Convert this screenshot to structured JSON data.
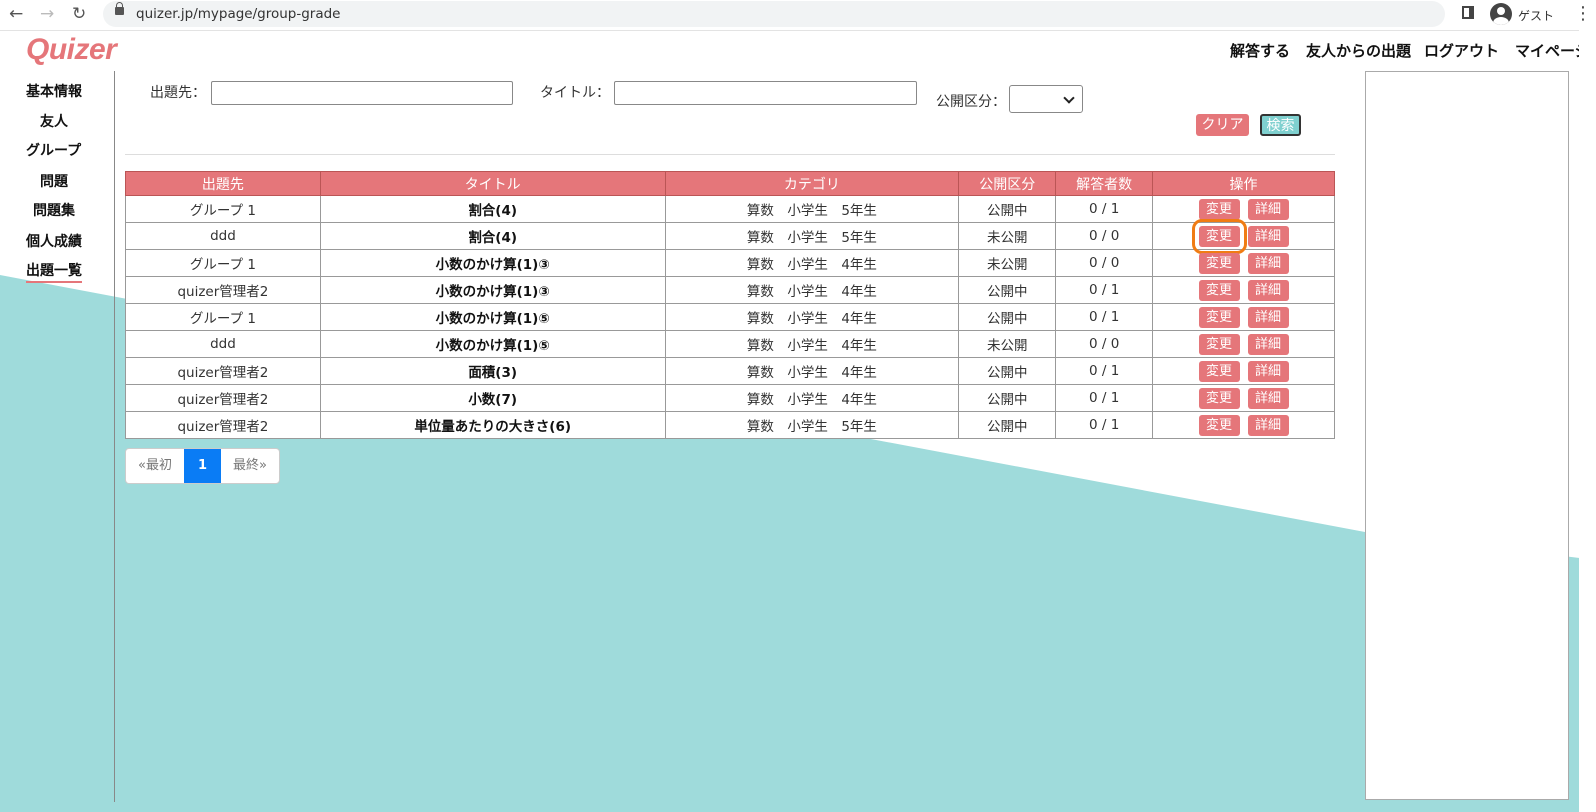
{
  "browser": {
    "url": "quizer.jp/mypage/group-grade",
    "profile": "ゲスト"
  },
  "header": {
    "logo": "Quizer",
    "nav": [
      "解答する",
      "友人からの出題",
      "ログアウト",
      "マイページ"
    ]
  },
  "sidebar": {
    "items": [
      "基本情報",
      "友人",
      "グループ",
      "問題",
      "問題集",
      "個人成績",
      "出題一覧"
    ],
    "active": "出題一覧"
  },
  "search": {
    "destination_label": "出題先：",
    "destination_value": "",
    "title_label": "タイトル：",
    "title_value": "",
    "visibility_label": "公開区分：",
    "visibility_value": "",
    "clear_label": "クリア",
    "search_label": "検索"
  },
  "table": {
    "headers": [
      "出題先",
      "タイトル",
      "カテゴリ",
      "公開区分",
      "解答者数",
      "操作"
    ],
    "edit_label": "変更",
    "detail_label": "詳細",
    "rows": [
      {
        "dest": "グループ 1",
        "title": "割合(4)",
        "category": "算数　小学生　5年生",
        "status": "公開中",
        "answers": "0 / 1"
      },
      {
        "dest": "ddd",
        "title": "割合(4)",
        "category": "算数　小学生　5年生",
        "status": "未公開",
        "answers": "0 / 0"
      },
      {
        "dest": "グループ 1",
        "title": "小数のかけ算(1)③",
        "category": "算数　小学生　4年生",
        "status": "未公開",
        "answers": "0 / 0"
      },
      {
        "dest": "quizer管理者2",
        "title": "小数のかけ算(1)③",
        "category": "算数　小学生　4年生",
        "status": "公開中",
        "answers": "0 / 1"
      },
      {
        "dest": "グループ 1",
        "title": "小数のかけ算(1)⑤",
        "category": "算数　小学生　4年生",
        "status": "公開中",
        "answers": "0 / 1"
      },
      {
        "dest": "ddd",
        "title": "小数のかけ算(1)⑤",
        "category": "算数　小学生　4年生",
        "status": "未公開",
        "answers": "0 / 0"
      },
      {
        "dest": "quizer管理者2",
        "title": "面積(3)",
        "category": "算数　小学生　4年生",
        "status": "公開中",
        "answers": "0 / 1"
      },
      {
        "dest": "quizer管理者2",
        "title": "小数(7)",
        "category": "算数　小学生　4年生",
        "status": "公開中",
        "answers": "0 / 1"
      },
      {
        "dest": "quizer管理者2",
        "title": "単位量あたりの大きさ(6)",
        "category": "算数　小学生　5年生",
        "status": "公開中",
        "answers": "0 / 1"
      }
    ]
  },
  "pagination": {
    "first": "«最初",
    "current": "1",
    "last": "最終»"
  },
  "colors": {
    "accent": "#e5767a",
    "teal": "#9fdbdb",
    "focus": "#f07c14",
    "page_active": "#0a7cf5"
  }
}
